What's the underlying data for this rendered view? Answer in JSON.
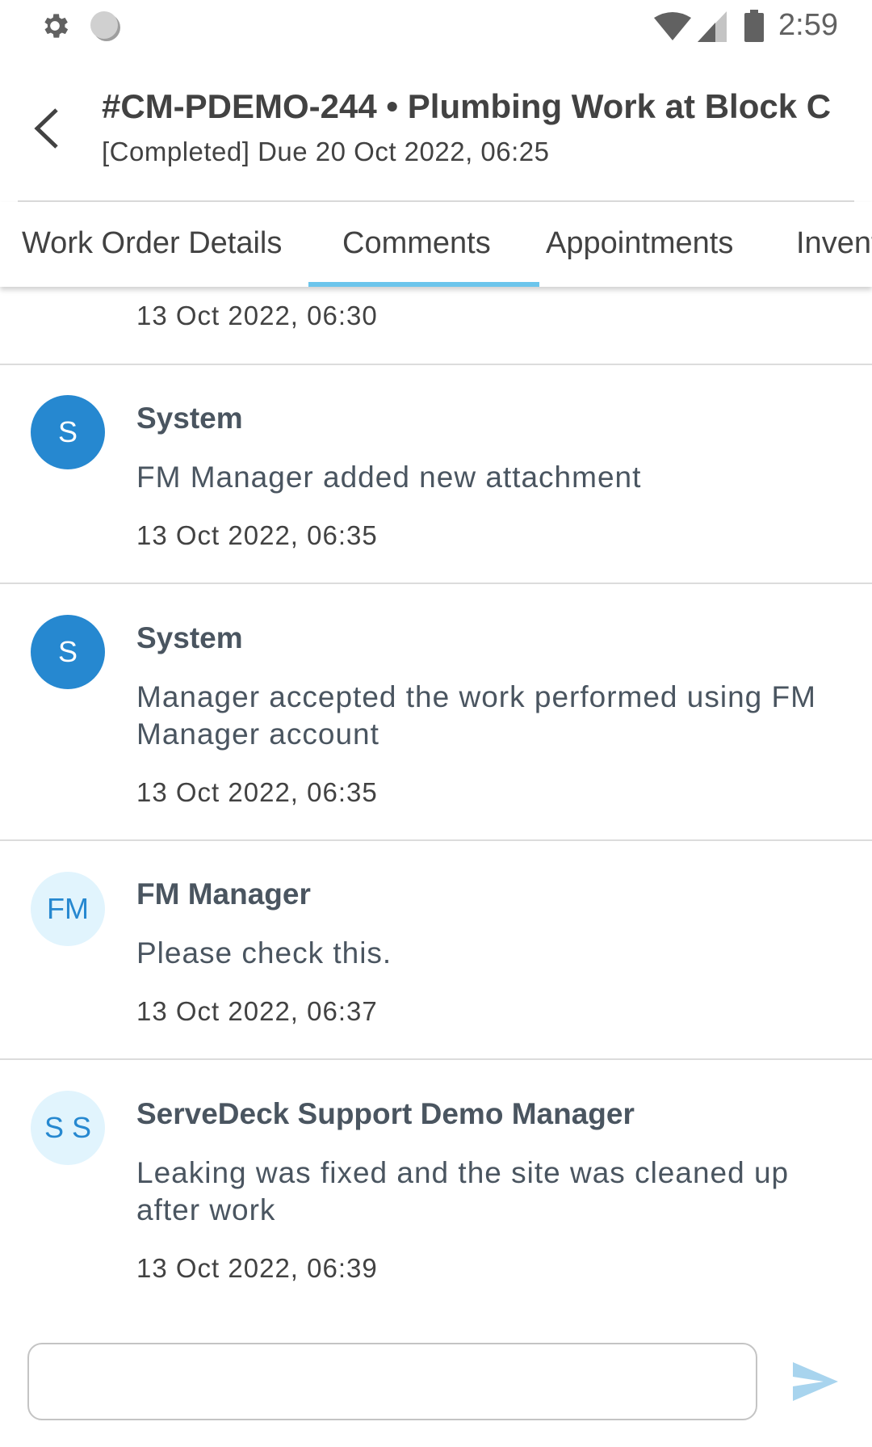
{
  "status_bar": {
    "left_icons": [
      "gear-icon",
      "circle-icon"
    ],
    "right_icons": [
      "wifi-icon",
      "cell-signal-icon",
      "battery-icon"
    ],
    "time": "2:59"
  },
  "header": {
    "back_icon": "chevron-left-icon",
    "title": "#CM-PDEMO-244 • Plumbing Work at Block C",
    "subtitle": "[Completed] Due 20 Oct 2022, 06:25"
  },
  "tabs": [
    {
      "label": "Work Order Details",
      "active": false
    },
    {
      "label": "Comments",
      "active": true
    },
    {
      "label": "Appointments",
      "active": false
    },
    {
      "label": "Inventory",
      "active": false
    }
  ],
  "colors": {
    "accent": "#6cc5ec",
    "system_avatar": "#2688d0",
    "user_avatar_bg": "#e1f4fd",
    "send_icon": "#a8d4ee"
  },
  "comments": {
    "partial_top_timestamp": "13 Oct 2022, 06:30",
    "items": [
      {
        "initials": "S",
        "author": "System",
        "message": "FM Manager added new attachment",
        "timestamp": "13 Oct 2022, 06:35",
        "avatar_type": "system"
      },
      {
        "initials": "S",
        "author": "System",
        "message": "Manager accepted the work performed using FM Manager account",
        "timestamp": "13 Oct 2022, 06:35",
        "avatar_type": "system"
      },
      {
        "initials": "FM",
        "author": "FM Manager",
        "message": "Please check this.",
        "timestamp": "13 Oct 2022, 06:37",
        "avatar_type": "user"
      },
      {
        "initials": "S S",
        "author": "ServeDeck Support Demo Manager",
        "message": "Leaking was fixed and the site was cleaned up after work",
        "timestamp": "13 Oct 2022, 06:39",
        "avatar_type": "user"
      }
    ]
  },
  "composer": {
    "value": "",
    "placeholder": "",
    "send_icon": "send-icon"
  }
}
